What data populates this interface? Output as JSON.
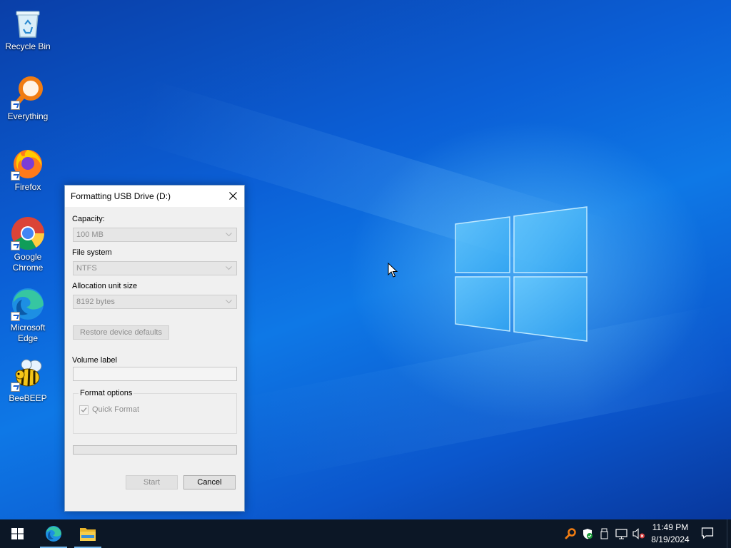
{
  "desktop": {
    "icons": [
      {
        "name": "recycle-bin",
        "label": "Recycle Bin"
      },
      {
        "name": "everything",
        "label": "Everything"
      },
      {
        "name": "firefox",
        "label": "Firefox"
      },
      {
        "name": "google-chrome",
        "label": "Google Chrome"
      },
      {
        "name": "microsoft-edge",
        "label": "Microsoft Edge"
      },
      {
        "name": "beebeep",
        "label": "BeeBEEP"
      }
    ]
  },
  "dialog": {
    "title": "Formatting USB Drive (D:)",
    "capacity_label": "Capacity:",
    "capacity_value": "100 MB",
    "filesystem_label": "File system",
    "filesystem_value": "NTFS",
    "allocation_label": "Allocation unit size",
    "allocation_value": "8192 bytes",
    "restore_label": "Restore device defaults",
    "volume_label": "Volume label",
    "volume_value": "",
    "format_options_label": "Format options",
    "quick_format_label": "Quick Format",
    "quick_format_checked": true,
    "progress_percent": 0,
    "start_label": "Start",
    "cancel_label": "Cancel"
  },
  "taskbar": {
    "pinned": [
      "microsoft-edge",
      "file-explorer"
    ],
    "tray_icons": [
      "everything-search-icon",
      "windows-security-icon",
      "usb-drive-icon",
      "network-icon",
      "volume-muted-icon"
    ],
    "time": "11:49 PM",
    "date": "8/19/2024"
  },
  "colors": {
    "accent": "#0078d7",
    "taskbar": "#0c1726",
    "progress": "#06b025"
  }
}
